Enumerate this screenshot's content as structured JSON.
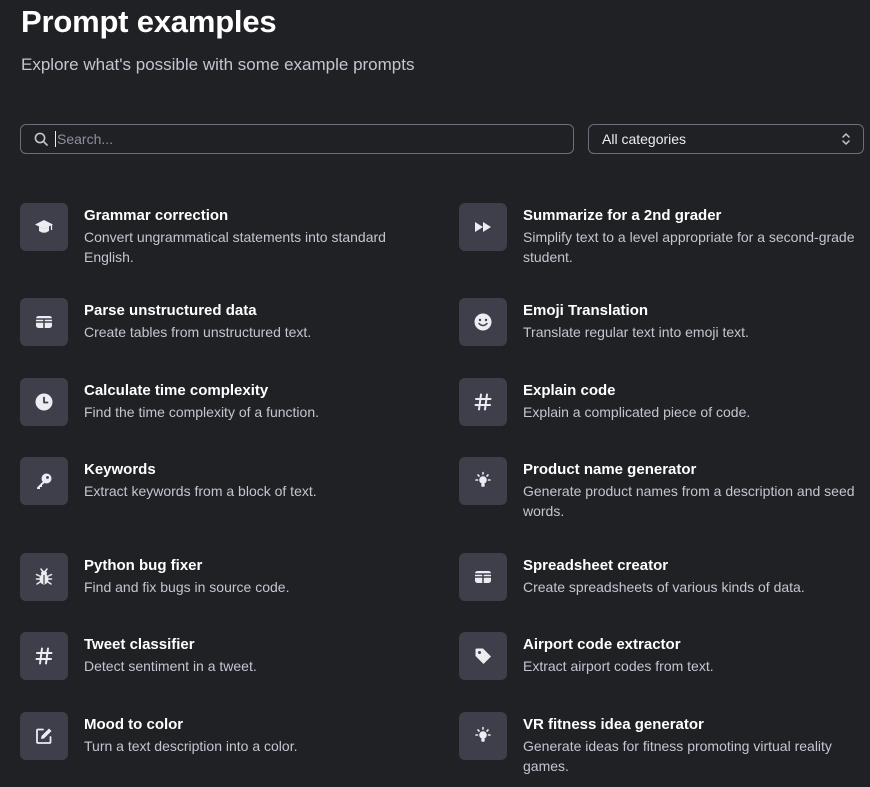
{
  "header": {
    "title": "Prompt examples",
    "subtitle": "Explore what's possible with some example prompts"
  },
  "search": {
    "placeholder": "Search...",
    "value": ""
  },
  "category_select": {
    "selected": "All categories"
  },
  "examples": [
    {
      "name": "Grammar correction",
      "desc": "Convert ungrammatical statements into standard English.",
      "icon": "graduation-cap-icon"
    },
    {
      "name": "Summarize for a 2nd grader",
      "desc": "Simplify text to a level appropriate for a second-grade student.",
      "icon": "fast-forward-icon"
    },
    {
      "name": "Parse unstructured data",
      "desc": "Create tables from unstructured text.",
      "icon": "table-icon"
    },
    {
      "name": "Emoji Translation",
      "desc": "Translate regular text into emoji text.",
      "icon": "smiley-icon"
    },
    {
      "name": "Calculate time complexity",
      "desc": "Find the time complexity of a function.",
      "icon": "clock-icon"
    },
    {
      "name": "Explain code",
      "desc": "Explain a complicated piece of code.",
      "icon": "hashtag-icon"
    },
    {
      "name": "Keywords",
      "desc": "Extract keywords from a block of text.",
      "icon": "key-icon"
    },
    {
      "name": "Product name generator",
      "desc": "Generate product names from a description and seed words.",
      "icon": "lightbulb-icon"
    },
    {
      "name": "Python bug fixer",
      "desc": "Find and fix bugs in source code.",
      "icon": "bug-icon"
    },
    {
      "name": "Spreadsheet creator",
      "desc": "Create spreadsheets of various kinds of data.",
      "icon": "table-icon"
    },
    {
      "name": "Tweet classifier",
      "desc": "Detect sentiment in a tweet.",
      "icon": "hashtag-icon"
    },
    {
      "name": "Airport code extractor",
      "desc": "Extract airport codes from text.",
      "icon": "tag-icon"
    },
    {
      "name": "Mood to color",
      "desc": "Turn a text description into a color.",
      "icon": "edit-icon"
    },
    {
      "name": "VR fitness idea generator",
      "desc": "Generate ideas for fitness promoting virtual reality games.",
      "icon": "lightbulb-icon"
    }
  ]
}
